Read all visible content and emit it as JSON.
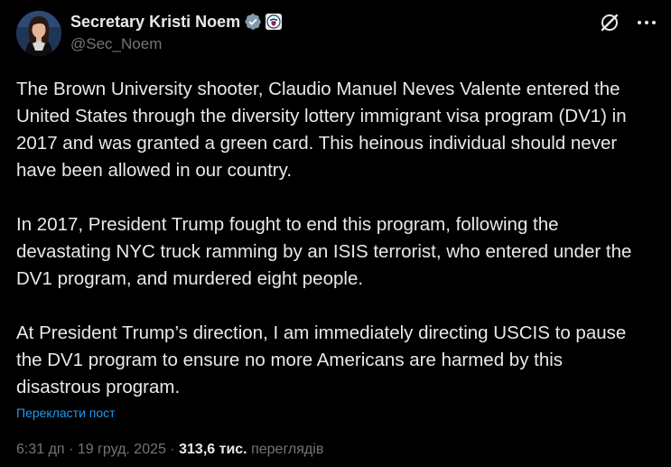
{
  "author": {
    "display_name": "Secretary Kristi Noem",
    "handle": "@Sec_Noem"
  },
  "post": {
    "paragraphs": [
      "The Brown University shooter, Claudio Manuel Neves Valente entered the\nUnited States through the diversity lottery immigrant visa program (DV1) in\n2017 and was granted a green card. This heinous individual should never\nhave been allowed in our country.",
      "In 2017, President Trump fought to end this program, following the\ndevastating NYC truck ramming by an ISIS terrorist, who entered under the\nDV1 program, and murdered eight people.",
      "At President Trump’s direction, I am immediately directing USCIS to pause\nthe DV1 program to ensure no more Americans are harmed by this\ndisastrous program."
    ],
    "translate_label": "Перекласти пост"
  },
  "meta": {
    "time": "6:31 дп",
    "separator": " · ",
    "date": "19 груд. 2025",
    "views_count": "313,6 тис.",
    "views_label": "переглядів"
  },
  "icons": {
    "verified": "verified-badge-icon",
    "affiliate": "dhs-seal-icon",
    "grok": "grok-icon",
    "more": "more-icon"
  },
  "colors": {
    "background": "#000000",
    "text": "#e7e9ea",
    "secondary": "#71767b",
    "link": "#1d9bf0",
    "verified_badge": "#829aab"
  }
}
